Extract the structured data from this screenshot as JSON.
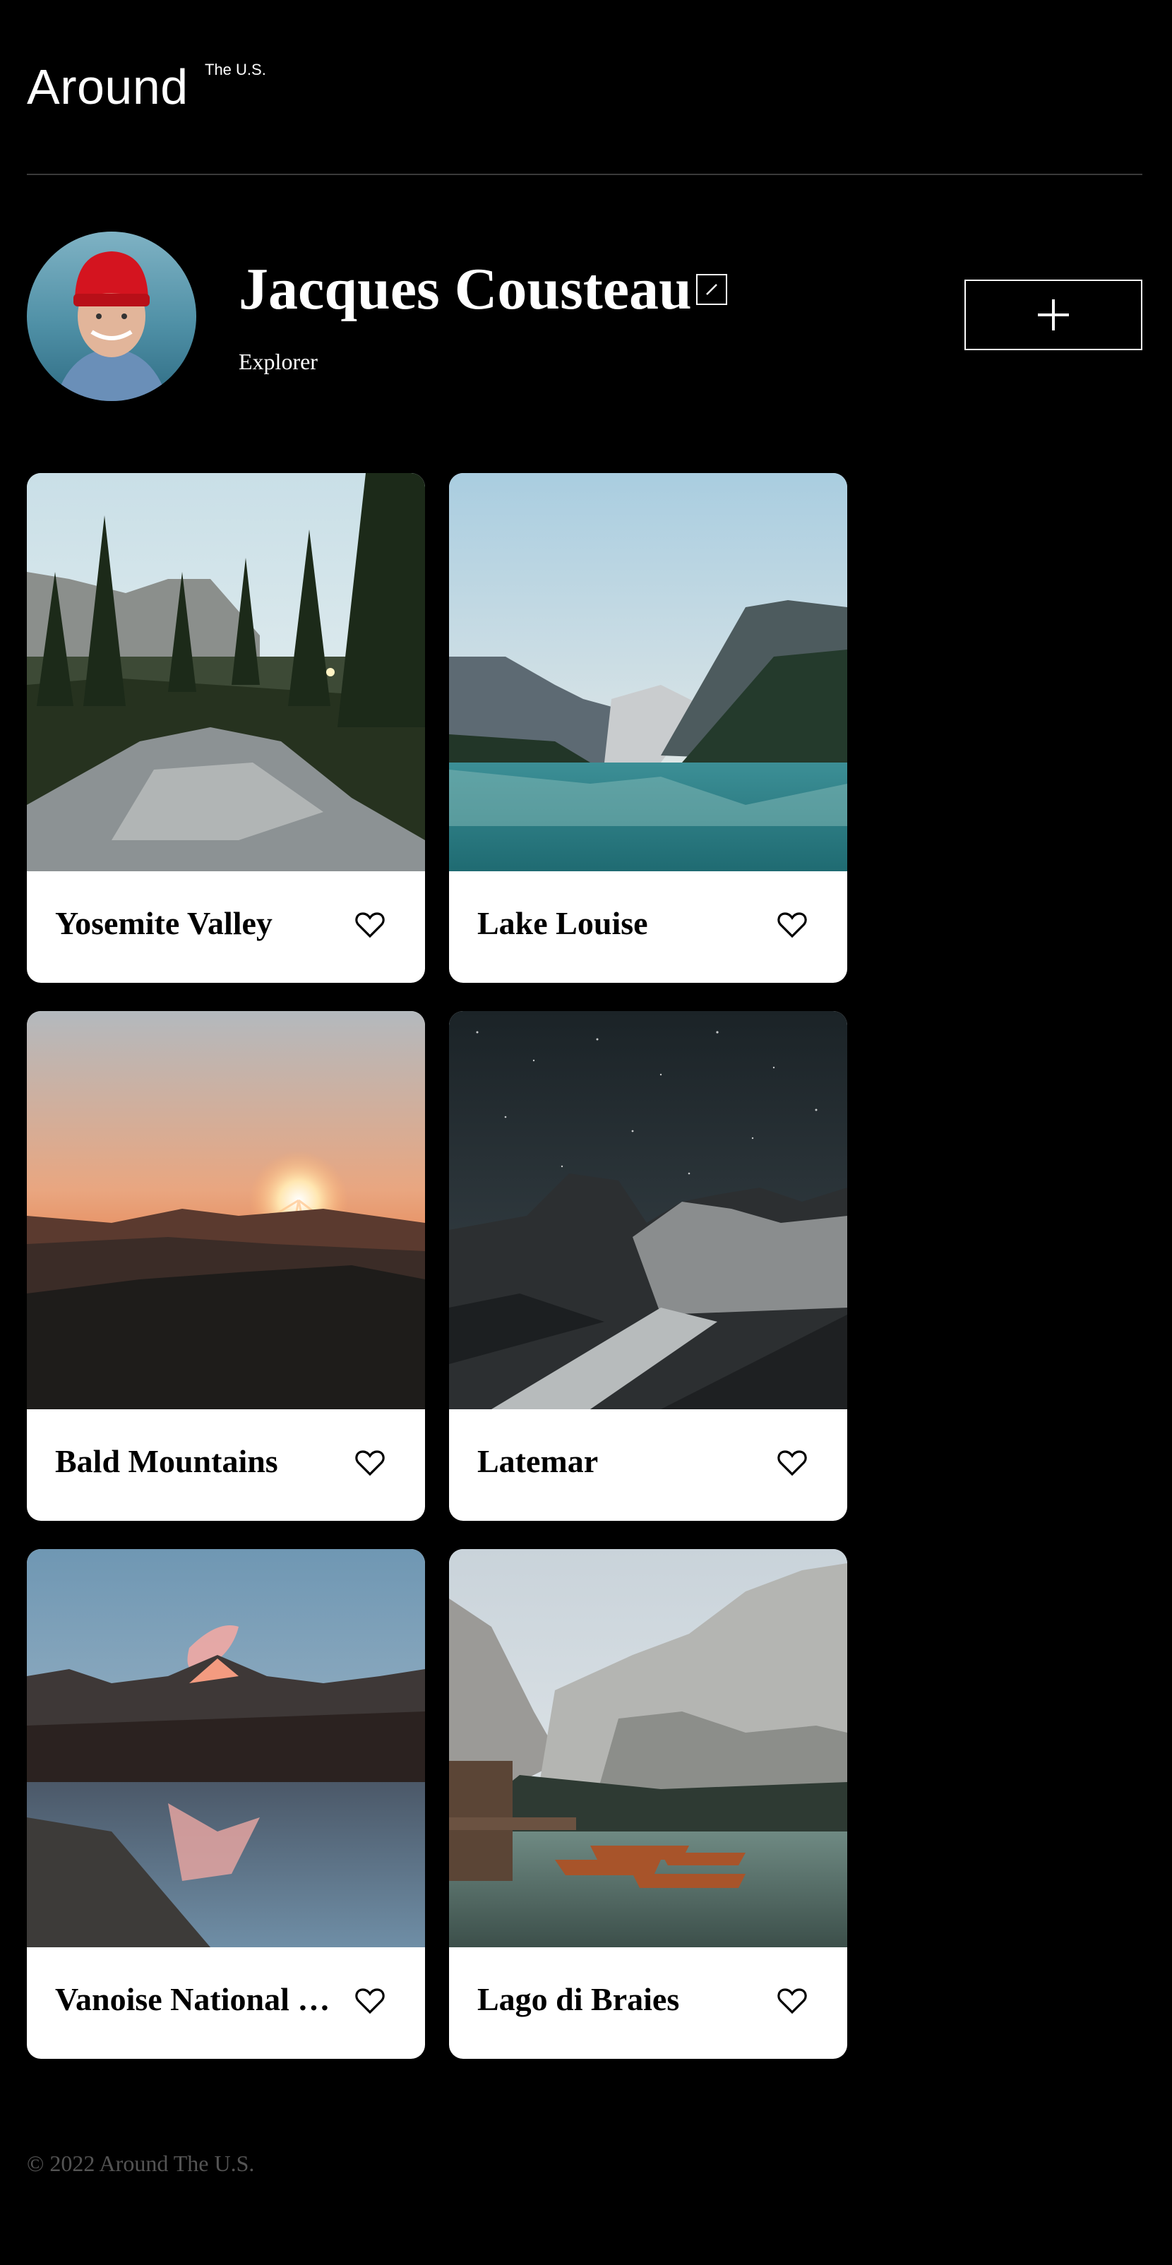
{
  "header": {
    "logo_main": "Around",
    "logo_sup": "The U.S."
  },
  "profile": {
    "name": "Jacques Cousteau",
    "about": "Explorer",
    "edit_icon": "pencil-icon",
    "add_icon": "plus-icon"
  },
  "cards": [
    {
      "title": "Yosemite Valley",
      "icon": "heart-icon"
    },
    {
      "title": "Lake Louise",
      "icon": "heart-icon"
    },
    {
      "title": "Bald Mountains",
      "icon": "heart-icon"
    },
    {
      "title": "Latemar",
      "icon": "heart-icon"
    },
    {
      "title": "Vanoise National Park",
      "icon": "heart-icon"
    },
    {
      "title": "Lago di Braies",
      "icon": "heart-icon"
    }
  ],
  "footer": {
    "copyright": "© 2022 Around The U.S."
  },
  "colors": {
    "background": "#000000",
    "card": "#ffffff",
    "divider": "#3a3a3a",
    "footer_text": "#545454"
  }
}
